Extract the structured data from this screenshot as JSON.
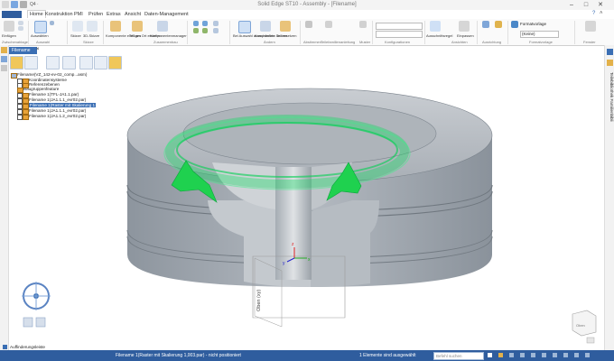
{
  "window": {
    "title": "Solid Edge ST10 - Assembly - [Filename]",
    "minimize": "–",
    "maximize": "□",
    "close": "✕"
  },
  "qat": {
    "more_label": "Q4 ·"
  },
  "menu": {
    "tabs": [
      "Home",
      "Konstruktion",
      "PMI",
      "Prüfen",
      "Extras",
      "Ansicht",
      "Daten-Management"
    ]
  },
  "ribbon": {
    "buttons": [
      {
        "label": "Einfügen"
      },
      {
        "label": "Auswählen"
      },
      {
        "label": "Skizze"
      },
      {
        "label": "3D-Skizze"
      },
      {
        "label": "Komponente einfügen"
      },
      {
        "label": "Teil am Ort erstellen"
      },
      {
        "label": "Komponentenmanager"
      },
      {
        "label": "Bei Auswahl ausschließen"
      },
      {
        "label": "Komponente ändern"
      },
      {
        "label": "Teil ersetzen"
      },
      {
        "label": "Ausschnittsregel",
        "is_link": true
      },
      {
        "label": "Einpassen"
      }
    ],
    "groups": [
      "Zwischenablage",
      "Auswahl",
      "Skizze",
      "Zusammenbau",
      "Ändern",
      "Abstimmen",
      "Teilefamilienanleitung",
      "Muster",
      "Konfigurationen",
      "Ansichten",
      "Ausrichtung",
      "Formatvorlage",
      "Fenster"
    ],
    "style_label": "Formatvorlage",
    "style_value": "(Keine)"
  },
  "document_tab": {
    "label": "Filename",
    "close": "×"
  },
  "tree": {
    "root": "Filename(VZ_142-ev-02_comp...asm)",
    "items": [
      {
        "label": "Koordinatensysteme",
        "level": 1,
        "type": "folder"
      },
      {
        "label": "Referenzebenen",
        "level": 1,
        "type": "folder"
      },
      {
        "label": "Baugruppenfeature",
        "level": 1,
        "type": "folder"
      },
      {
        "label": "Filename 1(TFL-JA1.1.par)",
        "level": 1,
        "type": "part"
      },
      {
        "label": "Filename 1(JA1.1.1_evr02.par)",
        "level": 1,
        "type": "part"
      },
      {
        "label": "Filename 1(Raster mit Skalierung 1",
        "level": 1,
        "type": "part",
        "selected": true
      },
      {
        "label": "Filename 1(JA1.1.1_evr02.par)",
        "level": 1,
        "type": "part"
      },
      {
        "label": "Filename 1(JA1.1.2_evr02.par)",
        "level": 1,
        "type": "part"
      }
    ]
  },
  "viewport": {
    "plane_label": "Oben (xy)",
    "axis_x": "x",
    "axis_y": "y",
    "axis_z": "z",
    "viewcube_label": "Oben",
    "colors": {
      "body": "#9aa2ab",
      "body_dark": "#7f8790",
      "body_light": "#c3c8cd",
      "highlight": "#00e05a",
      "background": "#ffffff"
    }
  },
  "find_bar": {
    "label": "Auffinderungsleiste"
  },
  "right_strip": {
    "label": "Teilebibliothek Familienbibli"
  },
  "status": {
    "left_message": "Filename 1(Raster mit Skalierung 1,003.par) - nicht positioniert",
    "selection": "1 Elemente sind ausgewählt",
    "command_hint": "Befehl suchen"
  }
}
